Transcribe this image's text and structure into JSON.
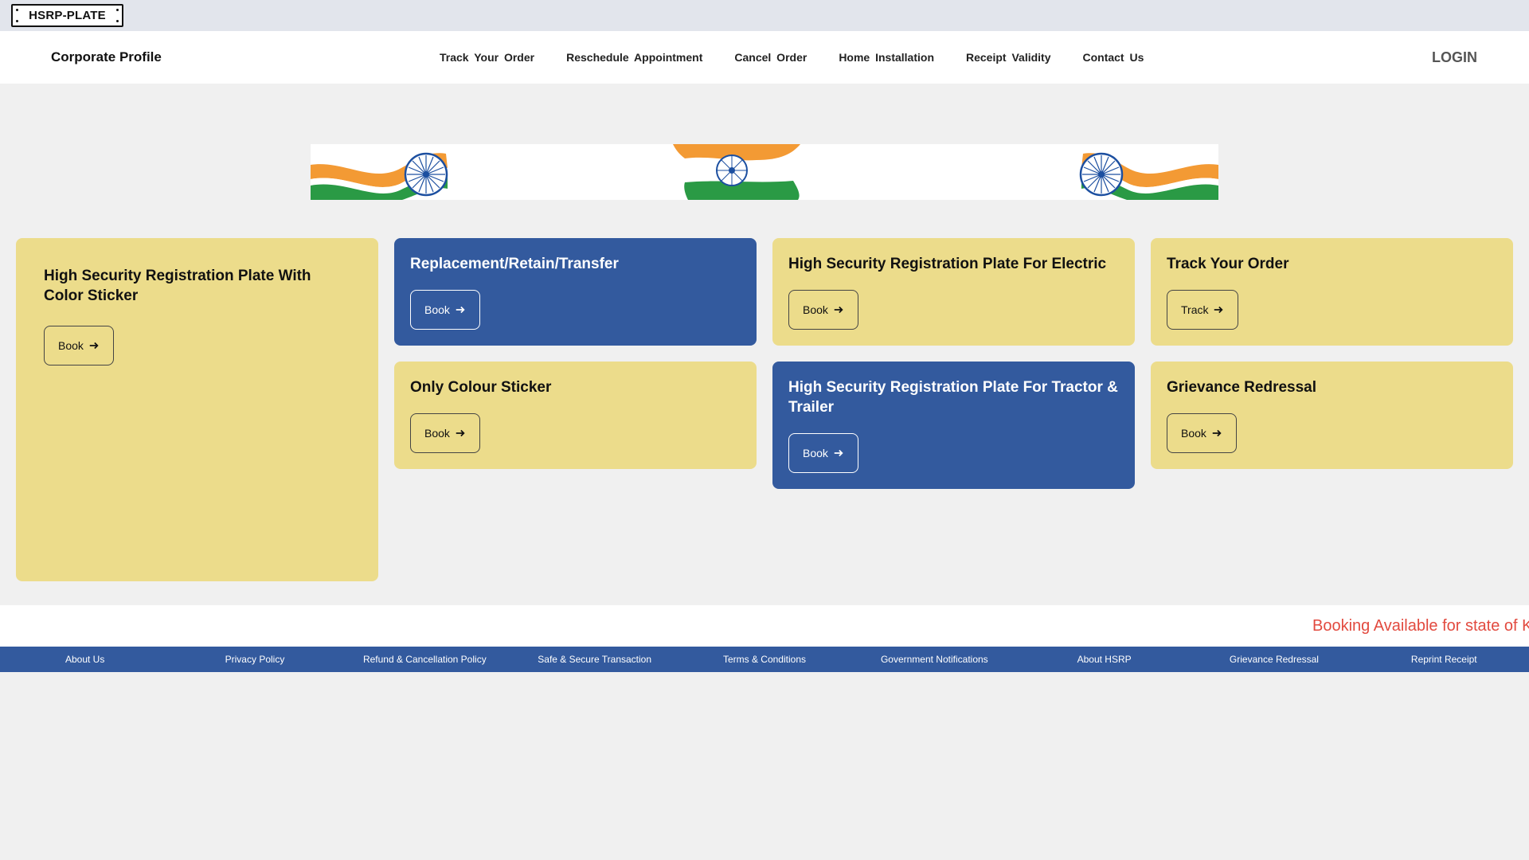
{
  "logo": {
    "text": "HSRP-PLATE"
  },
  "navbar": {
    "brand": "Corporate Profile",
    "links": [
      "Track Your Order",
      "Reschedule Appointment",
      "Cancel Order",
      "Home Installation",
      "Receipt Validity",
      "Contact Us"
    ],
    "login": "LOGIN"
  },
  "cards": [
    {
      "title": "High Security Registration Plate With Color Sticker",
      "button": "Book",
      "theme": "yellow"
    },
    {
      "title": "Replacement/Retain/Transfer",
      "button": "Book",
      "theme": "blue"
    },
    {
      "title": "High Security Registration Plate For Electric",
      "button": "Book",
      "theme": "yellow"
    },
    {
      "title": "Track Your Order",
      "button": "Track",
      "theme": "yellow"
    },
    {
      "title": "Only Colour Sticker",
      "button": "Book",
      "theme": "yellow"
    },
    {
      "title": "High Security Registration Plate For Tractor & Trailer",
      "button": "Book",
      "theme": "blue"
    },
    {
      "title": "Grievance Redressal",
      "button": "Book",
      "theme": "yellow"
    }
  ],
  "ticker": {
    "text": "Booking Available for state of K"
  },
  "footer": {
    "links": [
      "About Us",
      "Privacy Policy",
      "Refund & Cancellation Policy",
      "Safe & Secure Transaction",
      "Terms & Conditions",
      "Government Notifications",
      "About HSRP",
      "Grievance Redressal",
      "Reprint Receipt"
    ]
  },
  "colors": {
    "yellow_card": "#ecdc8b",
    "blue_card": "#335a9e",
    "ticker_text": "#e24a3f",
    "footer_bg": "#335a9e",
    "topbar_bg": "#e2e5ec"
  },
  "icons": {
    "button_arrow": "arrow-right-icon",
    "banner": "indian-flag-icon"
  }
}
